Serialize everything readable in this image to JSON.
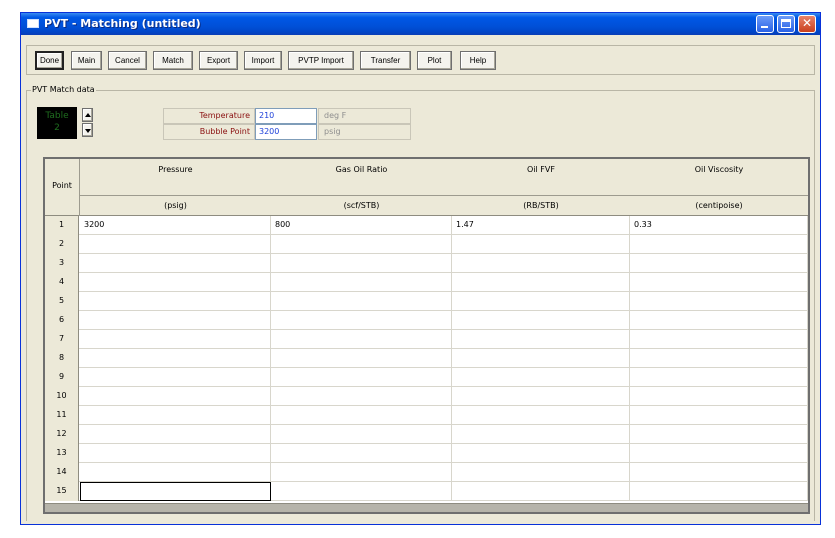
{
  "window": {
    "title": "PVT - Matching (untitled)"
  },
  "toolbar": {
    "done": "Done",
    "main": "Main",
    "cancel": "Cancel",
    "match": "Match",
    "export": "Export",
    "import": "Import",
    "pvtp_import": "PVTP Import",
    "transfer": "Transfer",
    "plot": "Plot",
    "help": "Help"
  },
  "match_data": {
    "group_label": "PVT Match data",
    "table_indicator": {
      "label": "Table",
      "number": "2"
    },
    "temperature": {
      "label": "Temperature",
      "value": "210",
      "unit": "deg F"
    },
    "bubble_point": {
      "label": "Bubble Point",
      "value": "3200",
      "unit": "psig"
    }
  },
  "grid": {
    "row_header": "Point",
    "columns": [
      {
        "name": "Pressure",
        "unit": "(psig)"
      },
      {
        "name": "Gas Oil Ratio",
        "unit": "(scf/STB)"
      },
      {
        "name": "Oil FVF",
        "unit": "(RB/STB)"
      },
      {
        "name": "Oil Viscosity",
        "unit": "(centipoise)"
      }
    ],
    "rows": [
      {
        "point": "1",
        "values": [
          "3200",
          "800",
          "1.47",
          "0.33"
        ]
      },
      {
        "point": "2",
        "values": [
          "",
          "",
          "",
          ""
        ]
      },
      {
        "point": "3",
        "values": [
          "",
          "",
          "",
          ""
        ]
      },
      {
        "point": "4",
        "values": [
          "",
          "",
          "",
          ""
        ]
      },
      {
        "point": "5",
        "values": [
          "",
          "",
          "",
          ""
        ]
      },
      {
        "point": "6",
        "values": [
          "",
          "",
          "",
          ""
        ]
      },
      {
        "point": "7",
        "values": [
          "",
          "",
          "",
          ""
        ]
      },
      {
        "point": "8",
        "values": [
          "",
          "",
          "",
          ""
        ]
      },
      {
        "point": "9",
        "values": [
          "",
          "",
          "",
          ""
        ]
      },
      {
        "point": "10",
        "values": [
          "",
          "",
          "",
          ""
        ]
      },
      {
        "point": "11",
        "values": [
          "",
          "",
          "",
          ""
        ]
      },
      {
        "point": "12",
        "values": [
          "",
          "",
          "",
          ""
        ]
      },
      {
        "point": "13",
        "values": [
          "",
          "",
          "",
          ""
        ]
      },
      {
        "point": "14",
        "values": [
          "",
          "",
          "",
          ""
        ]
      },
      {
        "point": "15",
        "values": [
          "",
          "",
          "",
          ""
        ]
      }
    ]
  },
  "icons": {
    "window": "window-icon",
    "minimize": "minimize-icon",
    "maximize": "maximize-icon",
    "close": "close-icon",
    "spin_up": "arrow-up-icon",
    "spin_down": "arrow-down-icon"
  },
  "colors": {
    "title_bar": "#0054e3",
    "label_text": "#8a1010",
    "input_text": "#1c3fd9",
    "unit_text": "#8e8e8e",
    "indicator_bg": "#000000"
  }
}
